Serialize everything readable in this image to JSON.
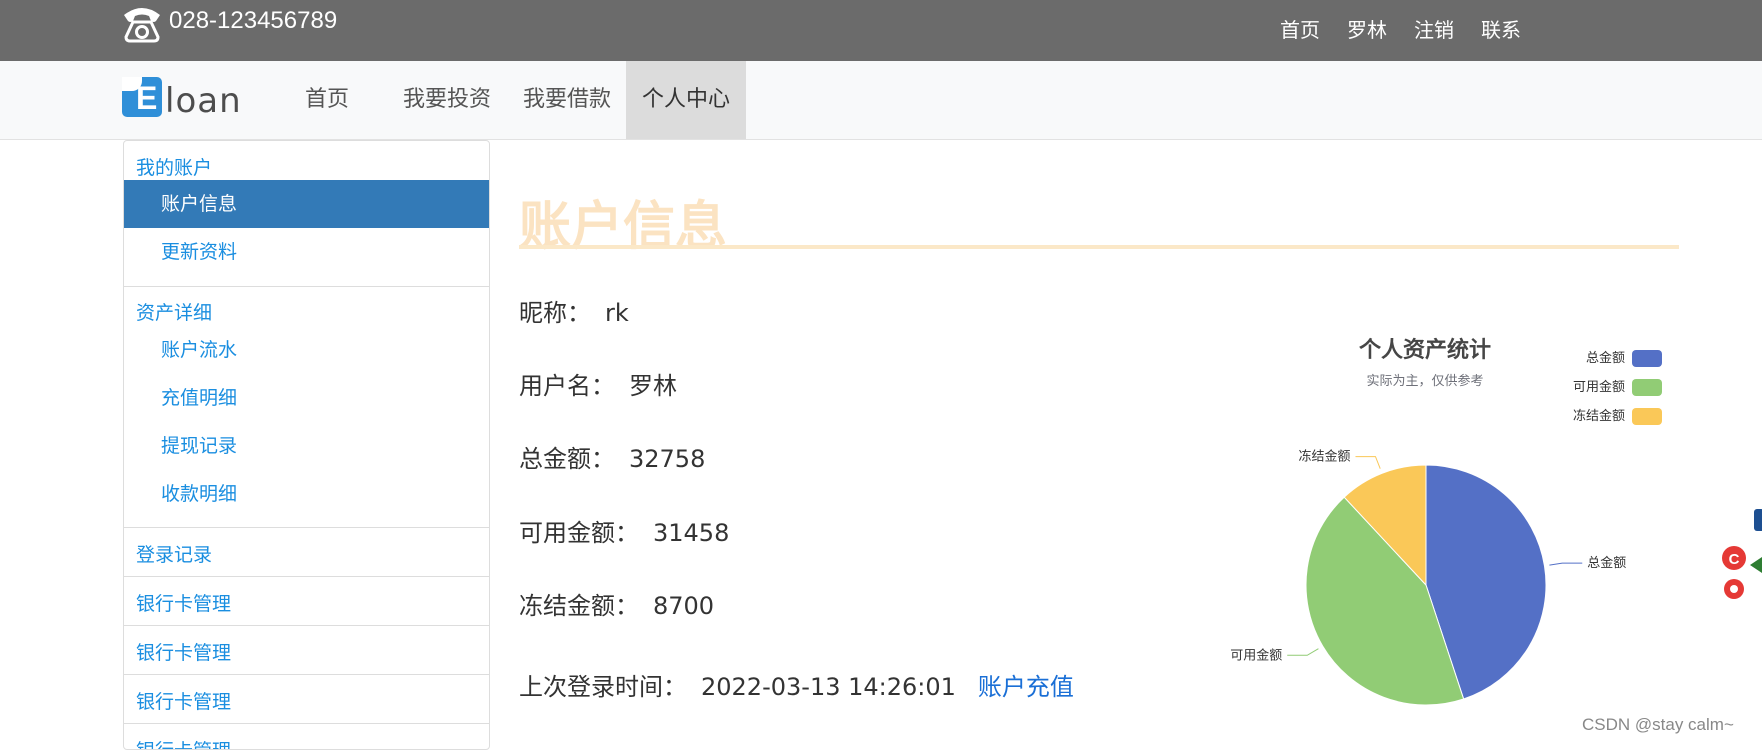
{
  "topbar": {
    "phone": "028-123456789",
    "links": [
      "首页",
      "罗林",
      "注销",
      "联系"
    ]
  },
  "navbar": {
    "logo_letter": "E",
    "logo_text": "loan",
    "items": [
      {
        "label": "首页",
        "active": false
      },
      {
        "label": "我要投资",
        "active": false
      },
      {
        "label": "我要借款",
        "active": false
      },
      {
        "label": "个人中心",
        "active": true
      }
    ]
  },
  "sidebar": {
    "account_head": "我的账户",
    "account_items": [
      "账户信息",
      "更新资料"
    ],
    "assets_head": "资产详细",
    "assets_items": [
      "账户流水",
      "充值明细",
      "提现记录",
      "收款明细"
    ],
    "links": [
      "登录记录",
      "银行卡管理",
      "银行卡管理",
      "银行卡管理",
      "银行卡管理"
    ]
  },
  "main": {
    "title": "账户信息",
    "nickname_label": "昵称：",
    "nickname": "rk",
    "username_label": "用户名：",
    "username": "罗林",
    "total_label": "总金额：",
    "total": "32758",
    "available_label": "可用金额：",
    "available": "31458",
    "frozen_label": "冻结金额：",
    "frozen": "8700",
    "last_login_label": "上次登录时间：",
    "last_login": "2022-03-13 14:26:01",
    "recharge_link": "账户充值"
  },
  "chart_data": {
    "type": "pie",
    "title": "个人资产统计",
    "subtitle": "实际为主，仅供参考",
    "legend_position": "top-right",
    "categories": [
      "总金额",
      "可用金额",
      "冻结金额"
    ],
    "values": [
      32758,
      31458,
      8700
    ],
    "colors": [
      "#5470c6",
      "#91cc75",
      "#fac858"
    ]
  },
  "footer": {
    "watermark": "CSDN @stay calm~"
  },
  "colors": {
    "topbar": "#6b6b6b",
    "link": "#1a8ee0",
    "active_sidebar": "#337ab7",
    "title": "#fbe3c2"
  }
}
